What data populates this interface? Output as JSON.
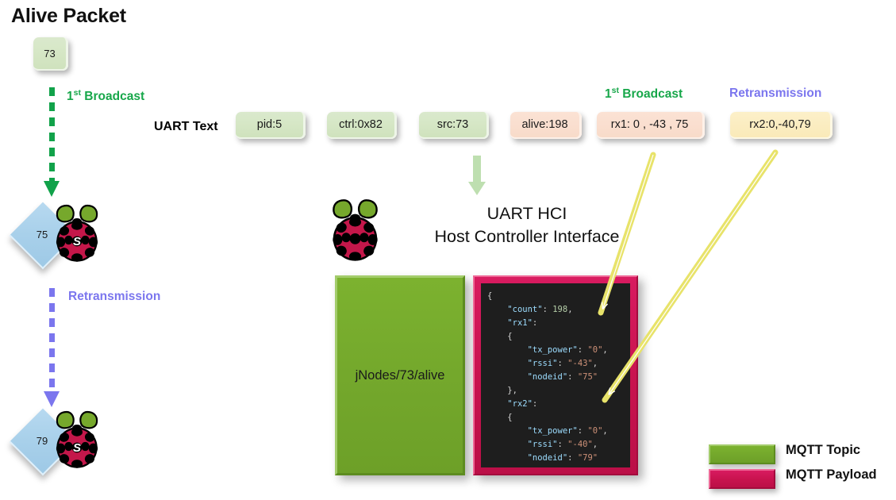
{
  "title": "Alive Packet",
  "left_flow": {
    "source_node": {
      "id": "73",
      "shape": "rounded-square",
      "color": "#d6e7c6"
    },
    "first_broadcast_label": {
      "prefix": "1",
      "sup": "st",
      "text": " Broadcast",
      "color": "#17a74a"
    },
    "retransmission_label": {
      "text": "Retransmission",
      "color": "#7b76ee"
    },
    "receiver_1": {
      "id": "75",
      "device": "raspberry-pi",
      "badge": "S"
    },
    "receiver_2": {
      "id": "79",
      "device": "raspberry-pi",
      "badge": "S"
    }
  },
  "uart": {
    "row_label": "UART Text",
    "fields": [
      {
        "text": "pid:5",
        "style": "green"
      },
      {
        "text": "ctrl:0x82",
        "style": "green"
      },
      {
        "text": "src:73",
        "style": "green"
      },
      {
        "text": "alive:198",
        "style": "peach"
      },
      {
        "text": "rx1:  0 , -43 , 75",
        "style": "peach"
      },
      {
        "text": "rx2:0,-40,79",
        "style": "cream"
      }
    ],
    "rx1_caption": {
      "prefix": "1",
      "sup": "st",
      "text": " Broadcast",
      "color": "#17a74a"
    },
    "rx2_caption": {
      "text": "Retransmission",
      "color": "#7b76ee"
    }
  },
  "hci": {
    "line1": "UART HCI",
    "line2": "Host Controller Interface",
    "device": "raspberry-pi"
  },
  "mqtt": {
    "topic": "jNodes/73/alive",
    "topic_color": "#74a82c",
    "payload_color": "#c9134f",
    "payload_lines": [
      {
        "indent": 0,
        "parts": [
          {
            "t": "{",
            "c": "punc"
          }
        ]
      },
      {
        "indent": 1,
        "parts": [
          {
            "t": "\"count\"",
            "c": "key"
          },
          {
            "t": ": ",
            "c": "punc"
          },
          {
            "t": "198",
            "c": "num"
          },
          {
            "t": ",",
            "c": "punc"
          }
        ]
      },
      {
        "indent": 1,
        "parts": [
          {
            "t": "\"rx1\"",
            "c": "key"
          },
          {
            "t": ":",
            "c": "punc"
          }
        ]
      },
      {
        "indent": 1,
        "parts": [
          {
            "t": "{",
            "c": "punc"
          }
        ]
      },
      {
        "indent": 2,
        "parts": [
          {
            "t": "\"tx_power\"",
            "c": "key"
          },
          {
            "t": ": ",
            "c": "punc"
          },
          {
            "t": "\"0\"",
            "c": "str"
          },
          {
            "t": ",",
            "c": "punc"
          }
        ]
      },
      {
        "indent": 2,
        "parts": [
          {
            "t": "\"rssi\"",
            "c": "key"
          },
          {
            "t": ": ",
            "c": "punc"
          },
          {
            "t": "\"-43\"",
            "c": "str"
          },
          {
            "t": ",",
            "c": "punc"
          }
        ]
      },
      {
        "indent": 2,
        "parts": [
          {
            "t": "\"nodeid\"",
            "c": "key"
          },
          {
            "t": ": ",
            "c": "punc"
          },
          {
            "t": "\"75\"",
            "c": "str"
          }
        ]
      },
      {
        "indent": 1,
        "parts": [
          {
            "t": "},",
            "c": "punc"
          }
        ]
      },
      {
        "indent": 1,
        "parts": [
          {
            "t": "\"rx2\"",
            "c": "key"
          },
          {
            "t": ":",
            "c": "punc"
          }
        ]
      },
      {
        "indent": 1,
        "parts": [
          {
            "t": "{",
            "c": "punc"
          }
        ]
      },
      {
        "indent": 2,
        "parts": [
          {
            "t": "\"tx_power\"",
            "c": "key"
          },
          {
            "t": ": ",
            "c": "punc"
          },
          {
            "t": "\"0\"",
            "c": "str"
          },
          {
            "t": ",",
            "c": "punc"
          }
        ]
      },
      {
        "indent": 2,
        "parts": [
          {
            "t": "\"rssi\"",
            "c": "key"
          },
          {
            "t": ": ",
            "c": "punc"
          },
          {
            "t": "\"-40\"",
            "c": "str"
          },
          {
            "t": ",",
            "c": "punc"
          }
        ]
      },
      {
        "indent": 2,
        "parts": [
          {
            "t": "\"nodeid\"",
            "c": "key"
          },
          {
            "t": ": ",
            "c": "punc"
          },
          {
            "t": "\"79\"",
            "c": "str"
          }
        ]
      },
      {
        "indent": 1,
        "parts": [
          {
            "t": "}",
            "c": "punc"
          }
        ]
      },
      {
        "indent": 0,
        "parts": [
          {
            "t": "}",
            "c": "punc"
          }
        ]
      }
    ]
  },
  "legend": [
    {
      "label": "MQTT Topic",
      "color": "#74a82c"
    },
    {
      "label": "MQTT Payload",
      "color": "#c9134f"
    }
  ],
  "colors": {
    "green_accent": "#17a74a",
    "purple_accent": "#7b76ee",
    "arrow_yellow": "#e8e36a",
    "pale_green_arrow": "#bedfb0",
    "raspberry_red": "#c4174a",
    "raspberry_leaf": "#76a82c"
  }
}
